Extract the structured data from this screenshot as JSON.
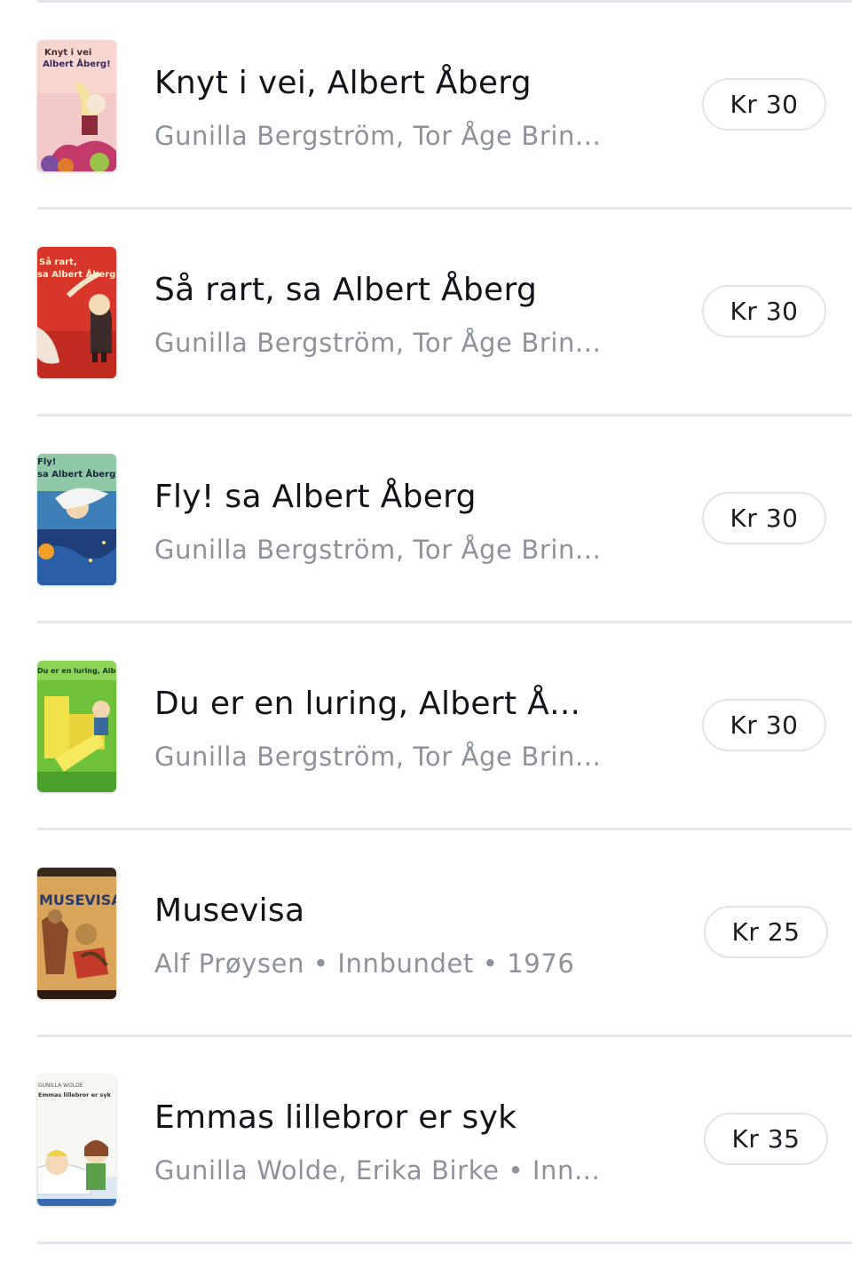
{
  "books": [
    {
      "title": "Knyt i vei, Albert Åberg",
      "subtitle": "Gunilla Bergström, Tor Åge Brin...",
      "price": "Kr 30",
      "cover_lines": [
        "Knyt i vei",
        "Albert Åberg!"
      ]
    },
    {
      "title": "Så rart, sa Albert Åberg",
      "subtitle": "Gunilla Bergström, Tor Åge Brin...",
      "price": "Kr 30",
      "cover_lines": [
        "Så rart,",
        "sa Albert Åberg"
      ]
    },
    {
      "title": "Fly! sa Albert Åberg",
      "subtitle": "Gunilla Bergström, Tor Åge Brin...",
      "price": "Kr 30",
      "cover_lines": [
        "Fly!",
        "sa Albert Åberg"
      ]
    },
    {
      "title": "Du er en luring, Albert Å...",
      "subtitle": "Gunilla Bergström, Tor Åge Brin...",
      "price": "Kr 30",
      "cover_lines": [
        "Du er en luring, Albert Åberg"
      ]
    },
    {
      "title": "Musevisa",
      "subtitle": "Alf Prøysen • Innbundet • 1976",
      "price": "Kr 25",
      "cover_lines": [
        "MUSEVISA"
      ]
    },
    {
      "title": "Emmas lillebror er syk",
      "subtitle": "Gunilla Wolde, Erika Birke • Inn...",
      "price": "Kr 35",
      "cover_lines": [
        "GUNILLA WOLDE",
        "Emmas lillebror er syk"
      ]
    }
  ]
}
